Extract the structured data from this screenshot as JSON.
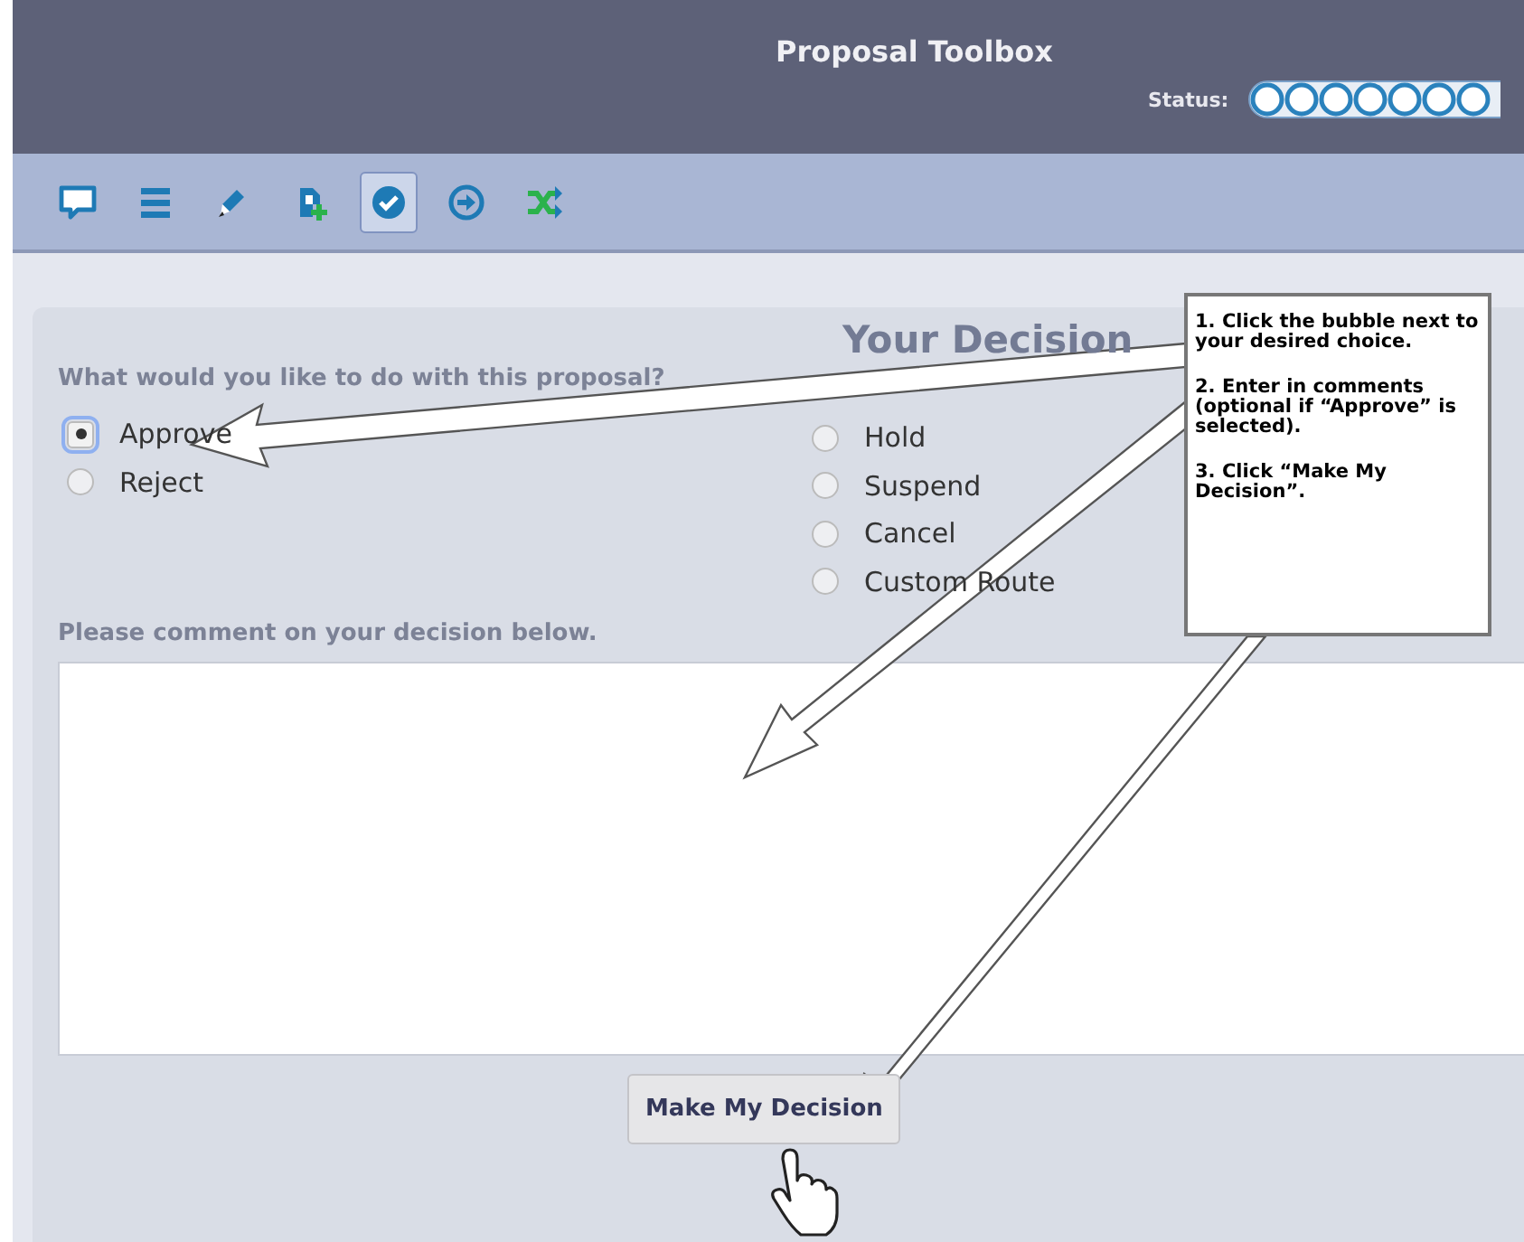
{
  "header": {
    "title": "Proposal Toolbox",
    "status_label": "Status:"
  },
  "toolbar": [
    {
      "kind": "comment",
      "selected": false
    },
    {
      "kind": "list",
      "selected": false
    },
    {
      "kind": "pen",
      "selected": false
    },
    {
      "kind": "add-doc",
      "selected": false
    },
    {
      "kind": "check",
      "selected": true
    },
    {
      "kind": "forward",
      "selected": false
    },
    {
      "kind": "shuffle",
      "selected": false
    }
  ],
  "decision": {
    "title": "Your Decision",
    "question": "What would you like to do with this proposal?",
    "option_columns": [
      [
        {
          "label": "Approve",
          "selected": true
        },
        {
          "label": "Reject",
          "selected": false
        }
      ],
      [
        {
          "label": "Hold",
          "selected": false
        },
        {
          "label": "Suspend",
          "selected": false
        },
        {
          "label": "Cancel",
          "selected": false
        },
        {
          "label": "Custom Route",
          "selected": false
        }
      ]
    ],
    "comment_label": "Please comment on your decision below.",
    "submit": "Make My Decision"
  },
  "callout": [
    "1. Click the bubble next to your desired choice.",
    "2. Enter in comments (optional if “Approve” is selected).",
    "3. Click “Make My Decision”."
  ]
}
